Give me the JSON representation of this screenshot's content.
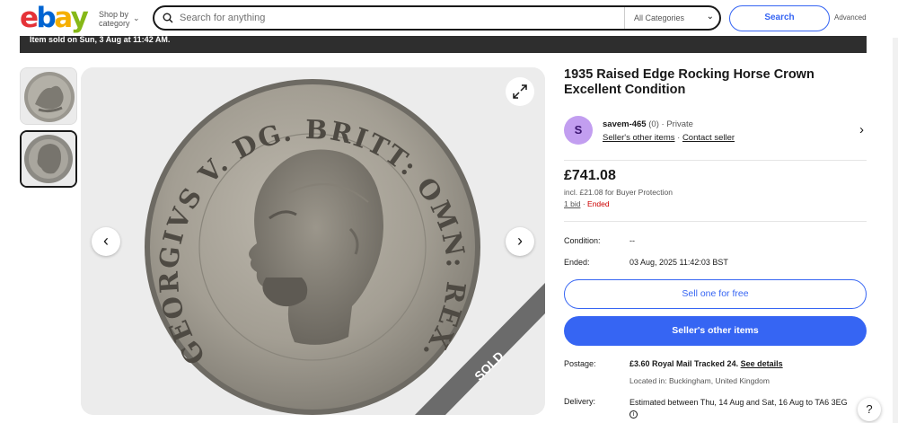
{
  "header": {
    "logo_letters": [
      "e",
      "b",
      "a",
      "y"
    ],
    "logo_colors": [
      "#e53238",
      "#0064d2",
      "#f5af02",
      "#86b817"
    ],
    "shop_by_line1": "Shop by",
    "shop_by_line2": "category",
    "search_placeholder": "Search for anything",
    "category_select": "All Categories",
    "search_button": "Search",
    "advanced_link": "Advanced"
  },
  "banner": {
    "text": "Item sold on Sun, 3 Aug at 11:42 AM."
  },
  "gallery": {
    "thumbnails": [
      "coin-reverse-rocking-horse",
      "coin-obverse-george-v"
    ],
    "selected_index": 1,
    "coin_inscription": "GEORGIVS V. DG. BRITT: OMN: REX. FD. IND. IMP:",
    "sold_ribbon": "SOLD",
    "prev_icon": "chevron-left-icon",
    "next_icon": "chevron-right-icon",
    "expand_icon": "expand-icon"
  },
  "listing": {
    "title": "1935 Raised Edge Rocking Horse Crown Excellent Condition",
    "seller": {
      "avatar_letter": "S",
      "name": "savem-465",
      "feedback": "(0)",
      "separator": "·",
      "type": "Private",
      "other_items_link": "Seller's other items",
      "contact_link": "Contact seller"
    },
    "price": "£741.08",
    "buyer_protection": "incl. £21.08 for Buyer Protection",
    "bids": "1 bid",
    "status": "Ended",
    "details": [
      {
        "label": "Condition:",
        "value": "--"
      },
      {
        "label": "Ended:",
        "value": "03 Aug, 2025 11:42:03 BST"
      }
    ],
    "sell_button": "Sell one for free",
    "other_items_button": "Seller's other items",
    "postage_label": "Postage:",
    "postage_value": "£3.60 Royal Mail Tracked 24.",
    "see_details": "See details",
    "located": "Located in: Buckingham, United Kingdom",
    "delivery_label": "Delivery:",
    "delivery_value": "Estimated between Thu, 14 Aug and Sat, 16 Aug to TA6 3EG",
    "help": "?"
  },
  "colors": {
    "accent": "#3665f3",
    "ended": "#cc0000",
    "banner": "#2e2e2e",
    "avatar": "#c29ef0"
  }
}
